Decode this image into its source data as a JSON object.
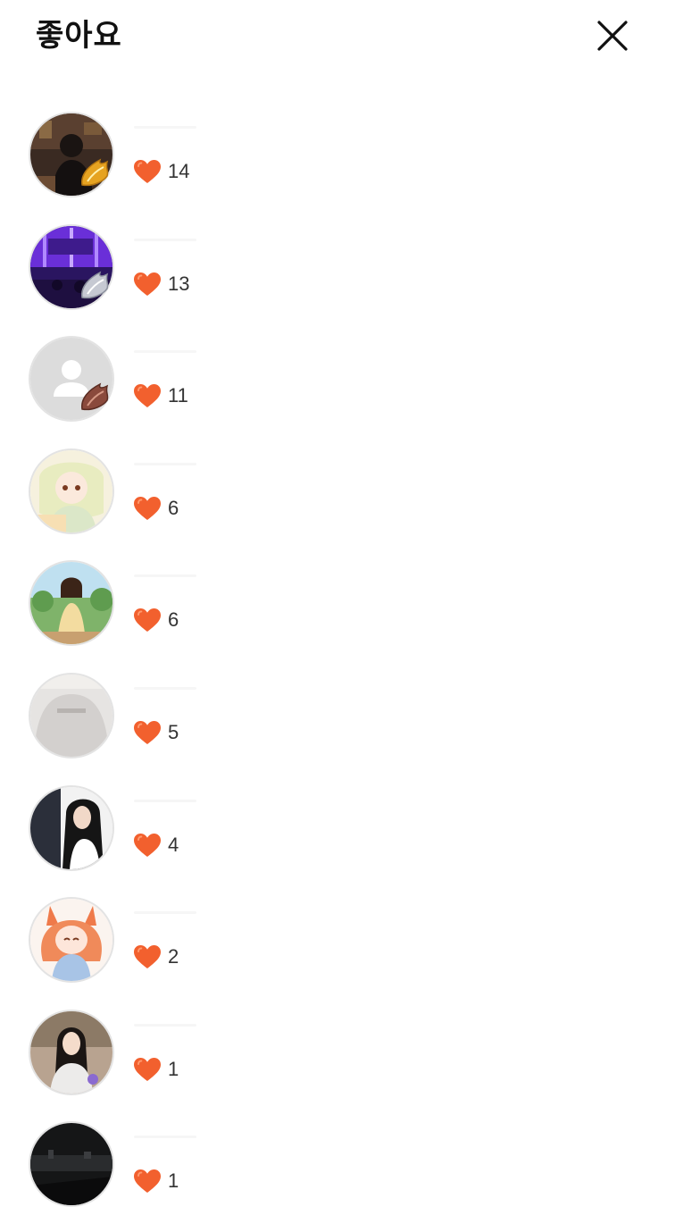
{
  "header": {
    "title": "좋아요",
    "close_icon": "close-icon"
  },
  "colors": {
    "heart": "#F2602E",
    "title": "#111111",
    "count": "#333333",
    "avatar_border": "#E3E3E3"
  },
  "likers": [
    {
      "count": "14",
      "badge": "gold-wing-badge"
    },
    {
      "count": "13",
      "badge": "silver-wing-badge"
    },
    {
      "count": "11",
      "badge": "bronze-wing-badge"
    },
    {
      "count": "6",
      "badge": ""
    },
    {
      "count": "6",
      "badge": ""
    },
    {
      "count": "5",
      "badge": ""
    },
    {
      "count": "4",
      "badge": ""
    },
    {
      "count": "2",
      "badge": ""
    },
    {
      "count": "1",
      "badge": ""
    },
    {
      "count": "1",
      "badge": ""
    }
  ]
}
